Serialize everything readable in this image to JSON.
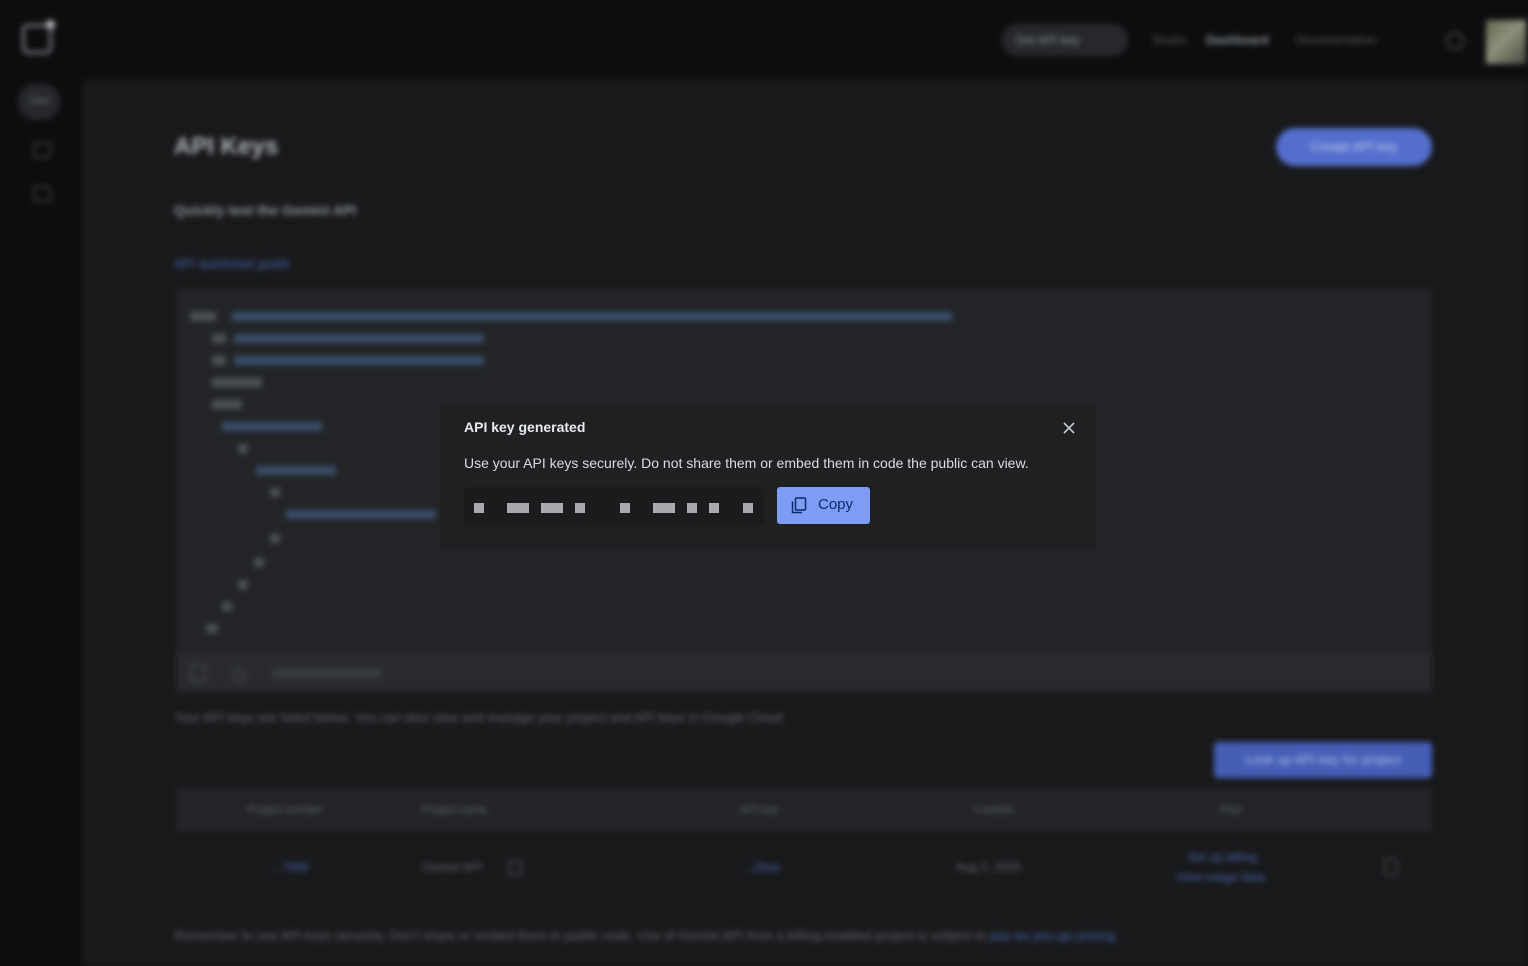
{
  "topbar": {
    "get_key_label": "Get API key",
    "nav": [
      "Studio",
      "Dashboard",
      "Documentation"
    ]
  },
  "sidebar": {
    "items": [
      {
        "label": "Dev"
      },
      {
        "icon": "analytics-icon"
      },
      {
        "icon": "docs-icon"
      }
    ]
  },
  "page": {
    "title": "API Keys",
    "create_button": "Create API key",
    "subtitle": "Quickly test the Gemini API",
    "quickstart_link": "API quickstart guide",
    "description": "Your API keys are listed below. You can also view and manage your project and API keys in Google Cloud.",
    "lookup_button": "Look up API key for project",
    "table": {
      "headers": [
        "Project number",
        "Project name",
        "API key",
        "Created",
        "Plan"
      ],
      "rows": [
        {
          "project_number": "...7058",
          "project_name": "Gemini API",
          "api_key": "...Zkxe",
          "created": "Aug 3, 2025",
          "plan_link_1": "Set up billing",
          "plan_link_2": "View usage data"
        }
      ]
    },
    "footer_note": "Remember to use API keys securely. Don't share or embed them in public code. Use of Gemini API from a billing-enabled project is subject to",
    "footer_link": "pay-as-you-go pricing."
  },
  "dialog": {
    "title": "API key generated",
    "message": "Use your API keys securely. Do not share them or embed them in code the public can view.",
    "copy_label": "Copy"
  },
  "colors": {
    "accent": "#7f9cf5",
    "dialog_bg": "#1e2022",
    "page_bg": "#1b1c1e"
  }
}
